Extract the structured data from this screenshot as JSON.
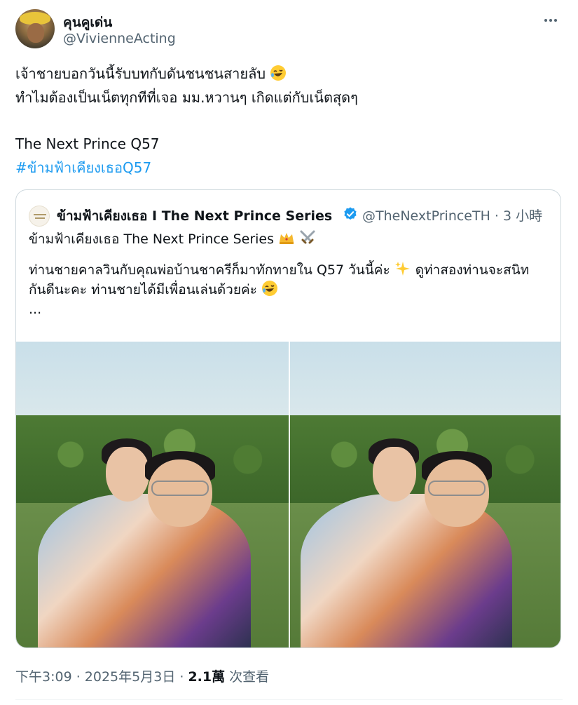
{
  "author": {
    "display_name": "คุนคูเด่น",
    "handle": "@VivienneActing"
  },
  "tweet": {
    "lines": [
      "เจ้าชายบอกวันนี้รับบทกับดันชนชนสายลับ",
      "ทำไมต้องเป็นเน็ตทุกทีที่เจอ มม.หวานๆ เกิดแต่กับเน็ตสุดๆ"
    ],
    "title_line": "The Next Prince Q57",
    "hashtag": "#ข้ามฟ้าเคียงเธอQ57",
    "emoji_after_line1": "rolling-on-floor-laughing-emoji"
  },
  "quoted": {
    "display_name": "ข้ามฟ้าเคียงเธอ I The Next Prince Series",
    "verified_icon": "verified-badge-icon",
    "handle_time": "@TheNextPrinceTH · 3 小時",
    "line1": "ข้ามฟ้าเคียงเธอ The Next Prince Series",
    "line2": "ท่านชายคาลวินกับคุณพ่อบ้านชาครีก็มาทักทายใน Q57 วันนี้ค่ะ",
    "line2b": "ดูท่าสองท่านจะสนิท",
    "line3": "กันดีนะคะ ท่านชายได้มีเพื่อนเล่นด้วยค่ะ",
    "ellipsis": "...",
    "photos": [
      "photo-left",
      "photo-right"
    ]
  },
  "meta": {
    "time": "下午3:09 · 2025年5月3日 · ",
    "views_count": "2.1萬",
    "views_label": " 次查看"
  },
  "colors": {
    "text": "#0f1419",
    "secondary": "#536471",
    "link": "#1d9bf0",
    "border": "#cfd9de"
  }
}
